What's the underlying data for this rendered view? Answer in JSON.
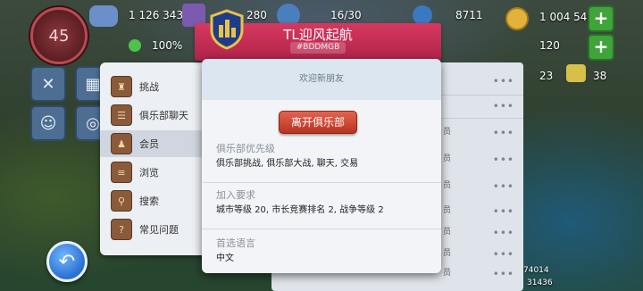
{
  "hud": {
    "level": "45",
    "population": "1 126 343",
    "slot_count": "280",
    "workers": "16/30",
    "simoleons": "8711",
    "coins": "1 004 540",
    "happiness_pct": "100%",
    "green_count": "120",
    "items_a": "23",
    "keys": "38",
    "bottom_num_1": "74014",
    "bottom_num_2": "31436"
  },
  "side_menu": {
    "items": [
      {
        "label": "挑战",
        "icon": "trophy-icon"
      },
      {
        "label": "俱乐部聊天",
        "icon": "chat-icon"
      },
      {
        "label": "会员",
        "icon": "members-icon"
      },
      {
        "label": "浏览",
        "icon": "browse-icon"
      },
      {
        "label": "搜索",
        "icon": "search-icon"
      },
      {
        "label": "常见问题",
        "icon": "faq-book-icon"
      }
    ]
  },
  "modal": {
    "club_name": "TL迎风起航",
    "club_tag": "#BDDMGB",
    "header_text": "欢迎新朋友",
    "leave_button": "离开俱乐部",
    "priorities_label": "俱乐部优先级",
    "priorities_value": "俱乐部挑战, 俱乐部大战, 聊天, 交易",
    "requirements_label": "加入要求",
    "requirements_value": "城市等级 20, 市长竞赛排名 2, 战争等级 2",
    "language_label": "首选语言",
    "language_value": "中文"
  },
  "right_list": {
    "partial_chars": [
      "员",
      "员",
      "员",
      "员",
      "员",
      "员",
      "员"
    ]
  },
  "colors": {
    "ribbon": "#c42a52",
    "leave_button": "#d04a35",
    "plus_button": "#3fa43a"
  }
}
